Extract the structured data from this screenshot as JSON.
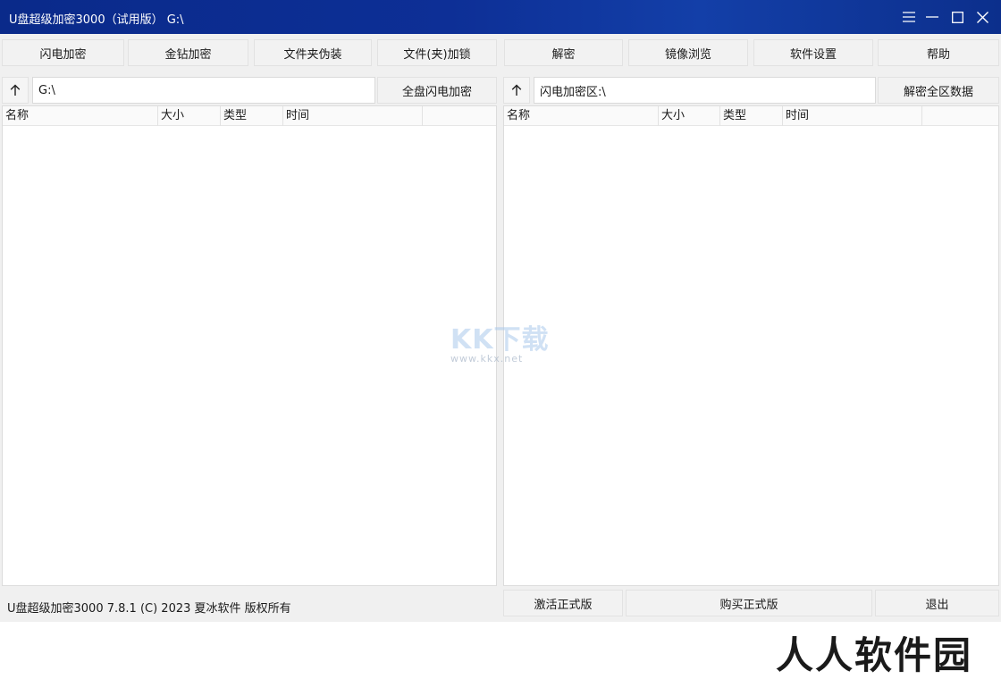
{
  "window": {
    "title": "U盘超级加密3000（试用版）   G:\\",
    "controls": [
      "menu-icon",
      "minimize-icon",
      "maximize-icon",
      "close-icon"
    ]
  },
  "toolbar": {
    "left": [
      "闪电加密",
      "金钻加密",
      "文件夹伪装",
      "文件(夹)加锁"
    ],
    "right": [
      "解密",
      "镜像浏览",
      "软件设置",
      "帮助"
    ]
  },
  "left_pane": {
    "path": "G:\\",
    "action": "全盘闪电加密",
    "columns": [
      "名称",
      "大小",
      "类型",
      "时间"
    ]
  },
  "right_pane": {
    "path": "闪电加密区:\\",
    "action": "解密全区数据",
    "columns": [
      "名称",
      "大小",
      "类型",
      "时间"
    ]
  },
  "status_bar": {
    "text": "U盘超级加密3000 7.8.1 (C) 2023 夏冰软件 版权所有"
  },
  "bottom_buttons": [
    "激活正式版",
    "购买正式版",
    "退出"
  ],
  "watermark": {
    "logo": "KK下载",
    "url": "www.kkx.net"
  },
  "corner_watermark": "人人软件园"
}
